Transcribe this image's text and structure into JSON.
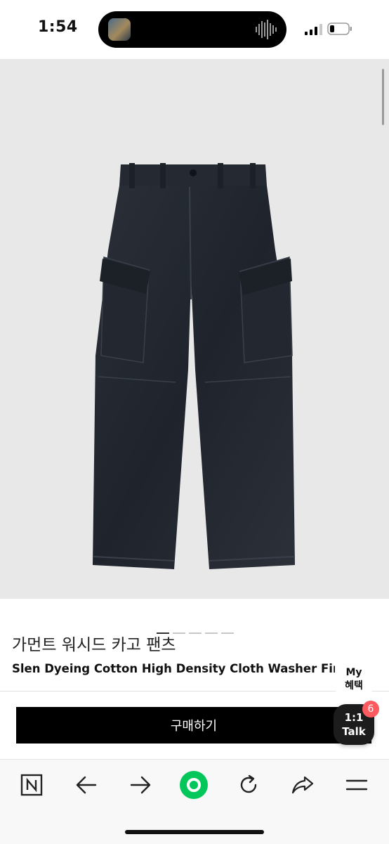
{
  "status_bar": {
    "time": "1:54"
  },
  "gallery": {
    "image_label": "pants-icon",
    "dots": [
      {
        "active": true
      },
      {
        "active": false
      },
      {
        "active": false
      },
      {
        "active": false
      },
      {
        "active": false
      }
    ]
  },
  "product": {
    "title_ko": "가먼트 워시드 카고 팬츠",
    "title_en": "Slen Dyeing Cotton High Density Cloth Washer Finish"
  },
  "actions": {
    "buy_label": "구매하기",
    "my_benefit_line1": "My",
    "my_benefit_line2": "혜택",
    "talk_line1": "1:1",
    "talk_line2": "Talk",
    "talk_badge": "6"
  },
  "toolbar": {
    "items": [
      "naver-n-icon",
      "back-arrow-icon",
      "forward-arrow-icon",
      "green-home-icon",
      "refresh-icon",
      "share-icon",
      "menu-icon"
    ]
  },
  "colors": {
    "buy_button": "#000000",
    "badge": "#ff5a5f",
    "home_green": "#03c75a",
    "gallery_bg": "#e8e8e8"
  }
}
